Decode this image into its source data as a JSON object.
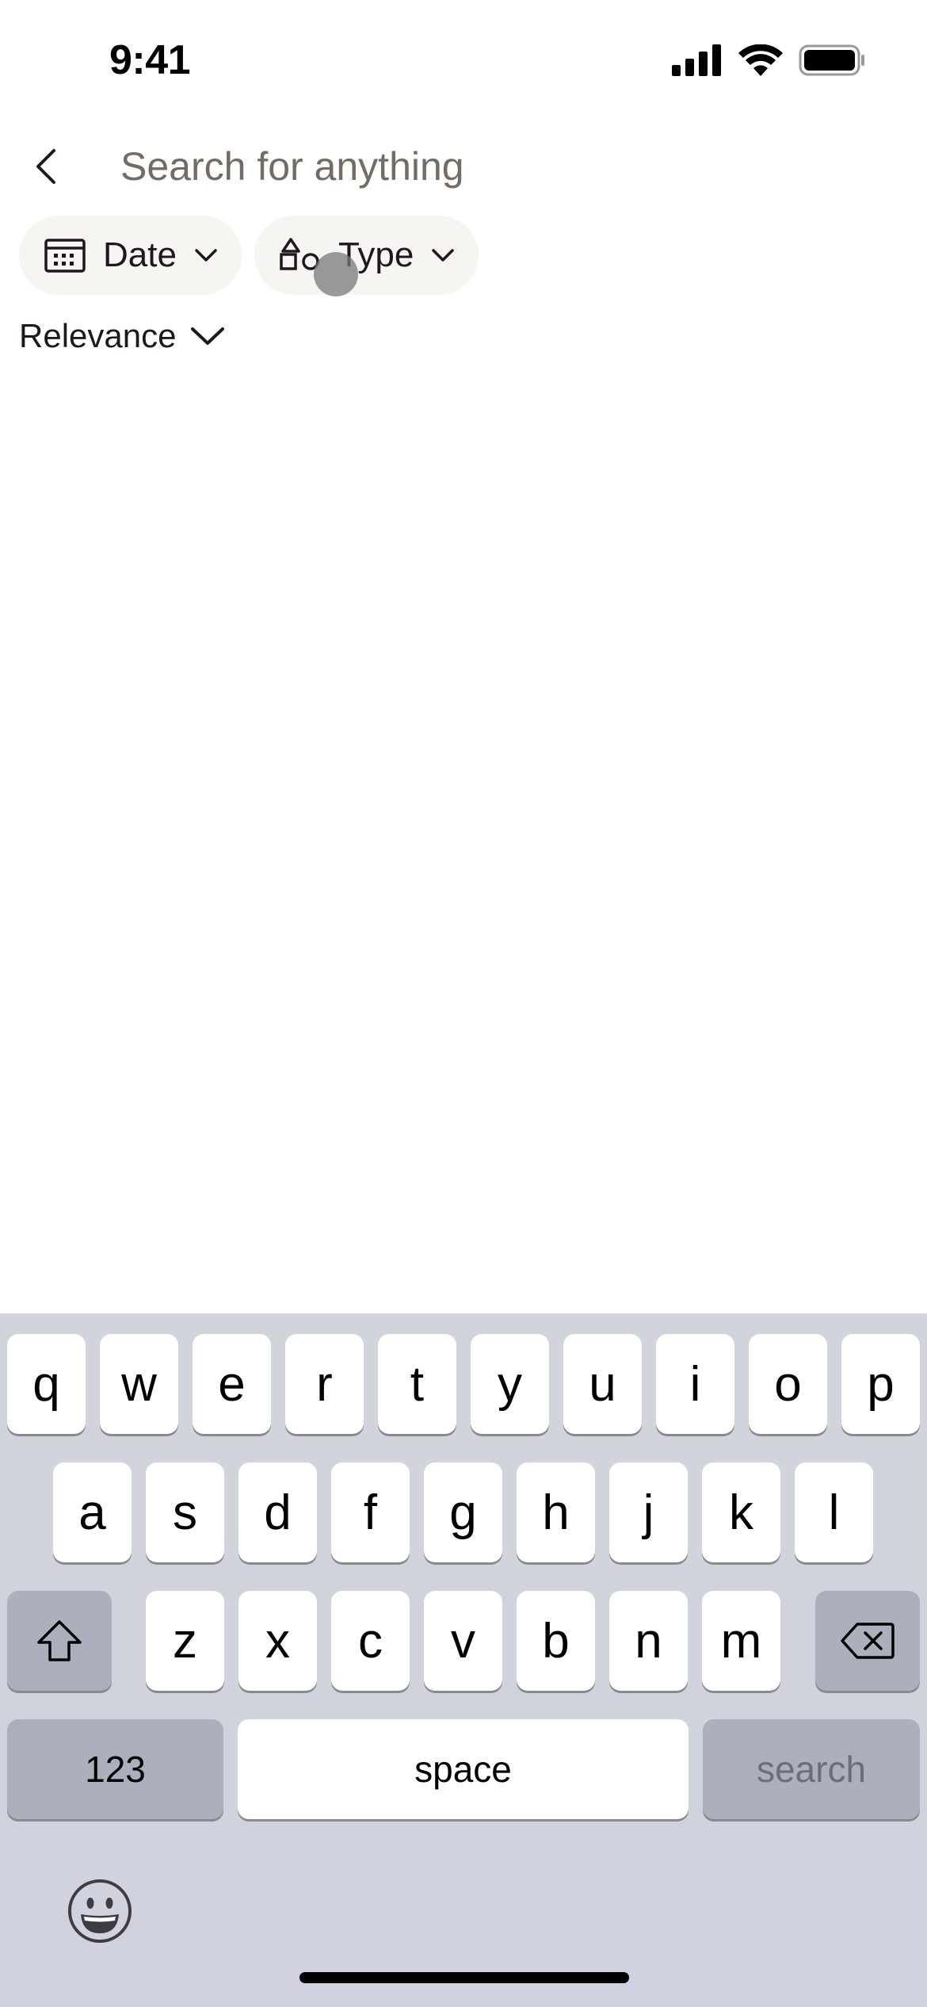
{
  "status_bar": {
    "time": "9:41",
    "icons": [
      "signal-icon",
      "wifi-icon",
      "battery-icon"
    ]
  },
  "search": {
    "placeholder": "Search for anything",
    "value": ""
  },
  "filters": [
    {
      "label": "Date",
      "icon": "calendar-icon"
    },
    {
      "label": "Type",
      "icon": "shapes-icon"
    }
  ],
  "sort": {
    "label": "Relevance"
  },
  "keyboard": {
    "row1": [
      "q",
      "w",
      "e",
      "r",
      "t",
      "y",
      "u",
      "i",
      "o",
      "p"
    ],
    "row2": [
      "a",
      "s",
      "d",
      "f",
      "g",
      "h",
      "j",
      "k",
      "l"
    ],
    "row3": [
      "z",
      "x",
      "c",
      "v",
      "b",
      "n",
      "m"
    ],
    "numbers_label": "123",
    "space_label": "space",
    "search_label": "search",
    "shift_icon": "shift-icon",
    "delete_icon": "backspace-icon",
    "emoji_icon": "emoji-icon"
  },
  "colors": {
    "chip_bg": "#f7f5f2",
    "text": "#1e1919",
    "placeholder": "#736c64",
    "keyboard_bg": "#d2d4dc",
    "dark_key": "#abb0bc"
  }
}
